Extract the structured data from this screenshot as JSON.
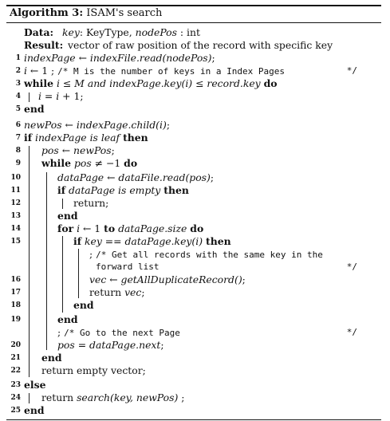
{
  "title": {
    "prefix": "Algorithm 3:",
    "name": "ISAM's search"
  },
  "header": [
    {
      "label": "Data:",
      "body": "key: KeyType, nodePos : int"
    },
    {
      "label": "Result:",
      "body": "vector of raw position of the record with specific key"
    }
  ],
  "lines": [
    {
      "n": "1",
      "text": "indexPage ← indexFile.read(nodePos);"
    },
    {
      "n": "2",
      "text": "i ← 1 ; /* M is the number of keys in a Index Pages",
      "comment_end": "*/"
    },
    {
      "n": "3",
      "text": "while i ≤ M and indexPage.key(i) ≤ record.key do"
    },
    {
      "n": "4",
      "text": "i = i + 1;"
    },
    {
      "n": "5",
      "text": "end"
    },
    {
      "n": "6",
      "text": "newPos ← indexPage.child(i);"
    },
    {
      "n": "7",
      "text": "if indexPage is leaf then"
    },
    {
      "n": "8",
      "text": "pos ← newPos;"
    },
    {
      "n": "9",
      "text": "while pos ≠ −1 do"
    },
    {
      "n": "10",
      "text": "dataPage ← dataFile.read(pos);"
    },
    {
      "n": "11",
      "text": "if dataPage is empty then"
    },
    {
      "n": "12",
      "text": "return;"
    },
    {
      "n": "13",
      "text": "end"
    },
    {
      "n": "14",
      "text": "for i ← 1 to dataPage.size do"
    },
    {
      "n": "15",
      "text": "if key == dataPage.key(i) then"
    },
    {
      "n": "",
      "text": "; /* Get all records with the same key in the",
      "comment_end": ""
    },
    {
      "n": "",
      "text": "forward list",
      "comment_end": "*/"
    },
    {
      "n": "16",
      "text": "vec ← getAllDuplicateRecord();"
    },
    {
      "n": "17",
      "text": "return vec;"
    },
    {
      "n": "18",
      "text": "end"
    },
    {
      "n": "19",
      "text": "end"
    },
    {
      "n": "",
      "text": "; /* Go to the next Page",
      "comment_end": "*/"
    },
    {
      "n": "20",
      "text": "pos = dataPage.next;"
    },
    {
      "n": "21",
      "text": "end"
    },
    {
      "n": "22",
      "text": "return empty vector;"
    },
    {
      "n": "23",
      "text": "else"
    },
    {
      "n": "24",
      "text": "return search(key, newPos) ;"
    },
    {
      "n": "25",
      "text": "end"
    }
  ]
}
